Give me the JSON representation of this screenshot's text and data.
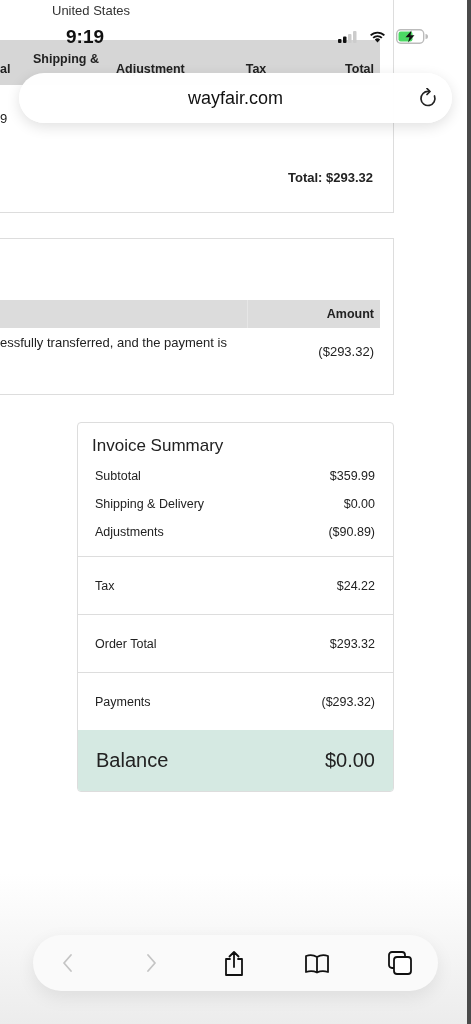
{
  "status_bar": {
    "time": "9:19"
  },
  "page": {
    "country": "United States"
  },
  "address_bar": {
    "url": "wayfair.com"
  },
  "items_table": {
    "columns": [
      "al",
      "Shipping &",
      "Adjustment",
      "Tax",
      "Total"
    ],
    "row_cell": "9",
    "total": "Total: $293.32"
  },
  "payments_table": {
    "columns": [
      "Amount"
    ],
    "rows": [
      {
        "description": "essfully transferred, and the payment is",
        "amount": "($293.32)"
      }
    ]
  },
  "invoice_summary": {
    "title": "Invoice Summary",
    "groups": [
      [
        {
          "label": "Subtotal",
          "value": "$359.99"
        },
        {
          "label": "Shipping & Delivery",
          "value": "$0.00"
        },
        {
          "label": "Adjustments",
          "value": "($90.89)"
        }
      ],
      [
        {
          "label": "Tax",
          "value": "$24.22"
        }
      ],
      [
        {
          "label": "Order Total",
          "value": "$293.32"
        }
      ],
      [
        {
          "label": "Payments",
          "value": "($293.32)"
        }
      ]
    ],
    "balance": {
      "label": "Balance",
      "value": "$0.00"
    }
  },
  "toolbar": {
    "buttons": [
      {
        "kind": "back",
        "disabled": true
      },
      {
        "kind": "forward",
        "disabled": true
      },
      {
        "kind": "share",
        "disabled": false
      },
      {
        "kind": "bookmarks",
        "disabled": false
      },
      {
        "kind": "tabs",
        "disabled": false
      }
    ]
  }
}
